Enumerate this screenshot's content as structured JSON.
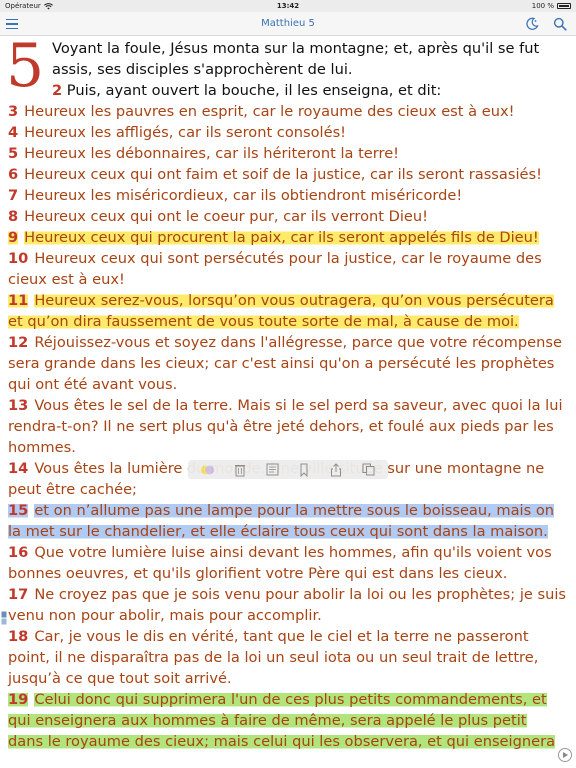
{
  "status": {
    "carrier": "Opérateur",
    "time": "13:42",
    "battery": "100 %"
  },
  "nav": {
    "title": "Matthieu 5"
  },
  "chapter": {
    "number": "5",
    "intro_text": "Voyant la foule, Jésus monta sur la montagne; et, après qu'il se fut assis, ses disciples s'approchèrent de lui.",
    "verse2_num": "2",
    "verse2_text": "Puis, ayant ouvert la bouche, il les enseigna, et dit:"
  },
  "verses": [
    {
      "num": "3",
      "text": "Heureux les pauvres en esprit, car le royaume des cieux est à eux!",
      "highlight": "none"
    },
    {
      "num": "4",
      "text": "Heureux les affligés, car ils seront consolés!",
      "highlight": "none"
    },
    {
      "num": "5",
      "text": "Heureux les débonnaires, car ils hériteront la terre!",
      "highlight": "none"
    },
    {
      "num": "6",
      "text": "Heureux ceux qui ont faim et soif de la justice, car ils seront rassasiés!",
      "highlight": "none"
    },
    {
      "num": "7",
      "text": "Heureux les miséricordieux, car ils obtiendront miséricorde!",
      "highlight": "none"
    },
    {
      "num": "8",
      "text": "Heureux ceux qui ont le coeur pur, car ils verront Dieu!",
      "highlight": "none"
    },
    {
      "num": "9",
      "text": "Heureux ceux qui procurent la paix, car ils seront appelés fils de Dieu!",
      "highlight": "yellow"
    },
    {
      "num": "10",
      "text": "Heureux ceux qui sont persécutés pour la justice, car le royaume des cieux est à eux!",
      "highlight": "none"
    },
    {
      "num": "11",
      "text": "Heureux serez-vous, lorsqu’on vous outragera, qu’on vous persécutera et qu’on dira faussement de vous toute sorte de mal, à cause de moi.",
      "highlight": "yellow"
    },
    {
      "num": "12",
      "text": "Réjouissez-vous et soyez dans l'allégresse, parce que votre récompense sera grande dans les cieux; car c'est ainsi qu'on a persécuté les prophètes qui ont été avant vous.",
      "highlight": "none"
    },
    {
      "num": "13",
      "text": "Vous êtes le sel de la terre. Mais si le sel perd sa saveur, avec quoi la lui rendra-t-on? Il ne sert plus qu'à être jeté dehors, et foulé aux pieds par les hommes.",
      "highlight": "none"
    },
    {
      "num": "14",
      "text": "Vous êtes la lumière du monde. Une ville située sur une montagne ne peut être cachée;",
      "highlight": "none"
    },
    {
      "num": "15",
      "text": "et on n’allume pas une lampe pour la mettre sous le boisseau, mais on la met sur le chandelier, et elle éclaire tous ceux qui sont dans la maison.",
      "highlight": "blue"
    },
    {
      "num": "16",
      "text": "Que votre lumière luise ainsi devant les hommes, afin qu'ils voient vos bonnes oeuvres, et qu'ils glorifient votre Père qui est dans les cieux.",
      "highlight": "none"
    },
    {
      "num": "17",
      "text": "Ne croyez pas que je sois venu pour abolir la loi ou les prophètes; je suis venu non pour abolir, mais pour accomplir.",
      "highlight": "none"
    },
    {
      "num": "18",
      "text": "Car, je vous le dis en vérité, tant que le ciel et la terre ne passeront point, il ne disparaîtra pas de la loi un seul iota ou un seul trait de lettre, jusqu’à ce que tout soit arrivé.",
      "highlight": "none"
    },
    {
      "num": "19",
      "text": "Celui donc qui supprimera l'un de ces plus petits commandements, et qui enseignera aux hommes à faire de même, sera appelé le plus petit dans le royaume des cieux; mais celui qui les observera, et qui enseignera",
      "highlight": "green"
    }
  ],
  "colors": {
    "verse_text": "#a84414",
    "verse_number": "#c0392b",
    "nav_accent": "#3a72b5",
    "highlight_yellow": "#ffe85a",
    "highlight_blue": "#96b9f0",
    "highlight_green": "#aae16e"
  },
  "toolbar_icons": [
    "color-palette-icon",
    "trash-icon",
    "note-icon",
    "bookmark-icon",
    "share-icon",
    "copy-icon"
  ]
}
